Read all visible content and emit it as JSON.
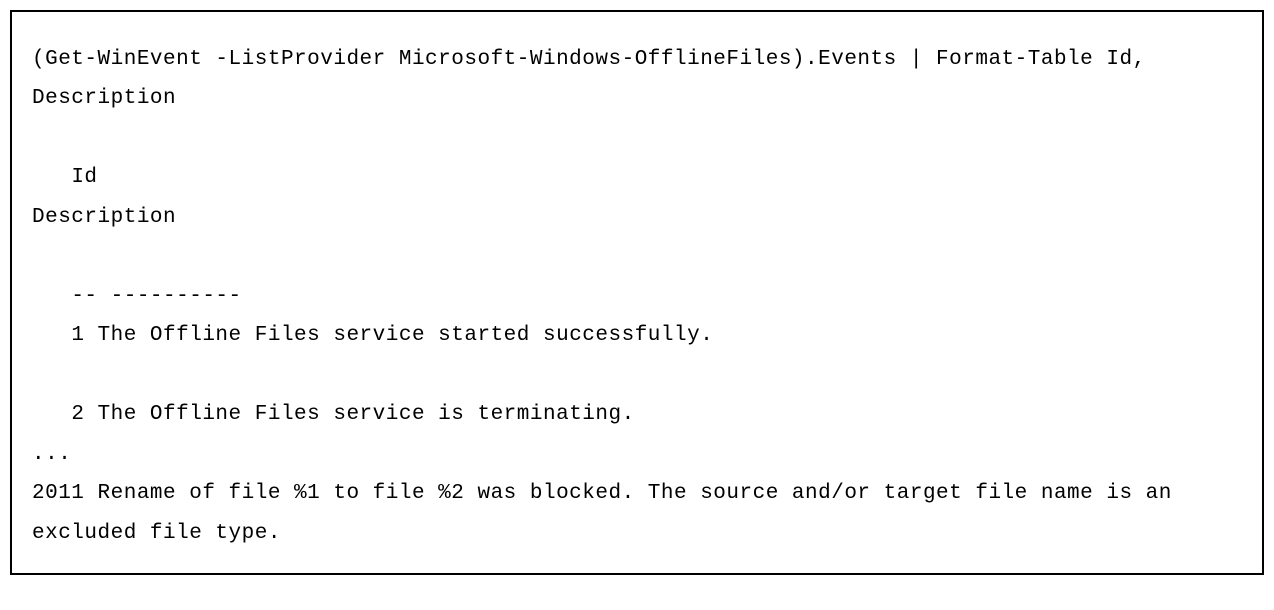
{
  "code": {
    "line1": "(Get-WinEvent -ListProvider Microsoft-Windows-OfflineFiles).Events | Format-Table Id, Description",
    "blank1": "",
    "header_id": "   Id",
    "header_desc": "Description",
    "blank2": "",
    "divider": "   -- ----------",
    "entry1": "   1 The Offline Files service started successfully.",
    "blank3": "",
    "entry2": "   2 The Offline Files service is terminating.",
    "ellipsis": "...",
    "entry2011": "2011 Rename of file %1 to file %2 was blocked. The source and/or target file name is an excluded file type."
  }
}
